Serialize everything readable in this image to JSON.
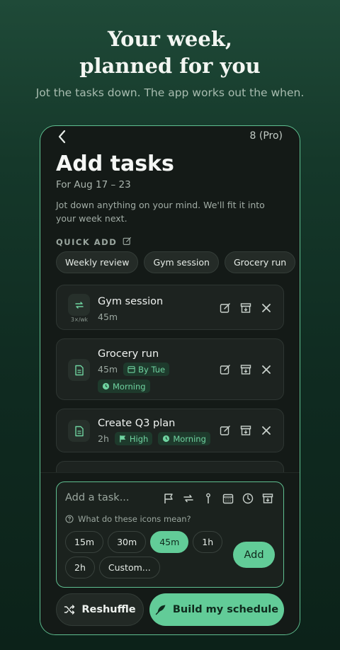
{
  "hero": {
    "title_line1": "Your week,",
    "title_line2": "planned for you",
    "subtitle": "Jot the tasks down. The app works out the when."
  },
  "header": {
    "back_icon": "chevron-left-icon",
    "page_counter": "8 (Pro)",
    "title": "Add tasks",
    "date_range": "For Aug 17 – 23",
    "description": "Jot down anything on your mind. We'll fit it into your week next."
  },
  "quick_add": {
    "label": "QUICK ADD",
    "icon": "edit-icon",
    "chips": [
      "Weekly review",
      "Gym session",
      "Grocery run"
    ]
  },
  "tasks": [
    {
      "title": "Gym session",
      "duration": "45m",
      "icon": "repeat-icon",
      "repeat": "3×/wk"
    },
    {
      "title": "Grocery run",
      "duration": "45m",
      "icon": "document-icon",
      "due_tag": "By Tue",
      "time_tag": "Morning"
    },
    {
      "title": "Create Q3 plan",
      "duration": "2h",
      "icon": "document-icon",
      "priority_tag": "High",
      "time_tag": "Morning"
    }
  ],
  "composer": {
    "placeholder": "Add a task...",
    "tool_icons": [
      "flag-icon",
      "repeat-icon",
      "pin-icon",
      "calendar-icon",
      "clock-icon",
      "archive-icon"
    ],
    "help_text": "What do these icons mean?",
    "durations_row1": [
      "15m",
      "30m",
      "45m",
      "1h"
    ],
    "durations_row2": [
      "2h",
      "Custom..."
    ],
    "selected_duration": "45m",
    "add_label": "Add"
  },
  "actions": {
    "reshuffle_label": "Reshuffle",
    "build_label": "Build my schedule"
  },
  "colors": {
    "accent": "#62cc98",
    "background": "#141a17",
    "card": "#1d2320",
    "tag_bg": "#1e3a2c"
  }
}
